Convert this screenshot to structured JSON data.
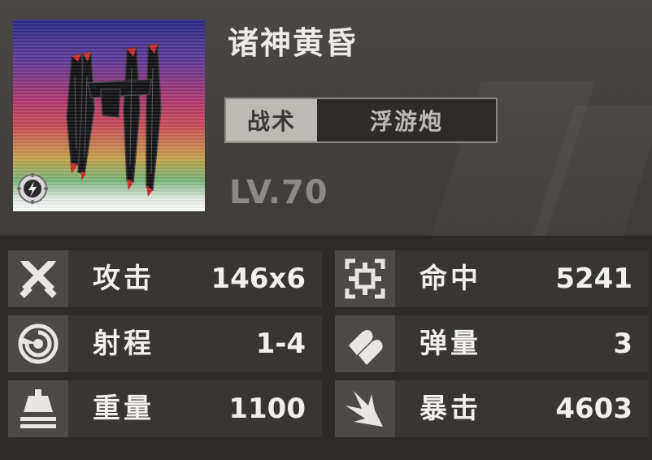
{
  "equipment": {
    "name": "诸神黄昏",
    "category": "战术",
    "type": "浮游炮",
    "level": "LV.70",
    "badge": "lightning-badge-icon"
  },
  "stats": [
    {
      "label": "攻击",
      "value": "146x6",
      "icon": "crossed-swords-icon"
    },
    {
      "label": "命中",
      "value": "5241",
      "icon": "crosshair-icon"
    },
    {
      "label": "射程",
      "value": "1-4",
      "icon": "radar-icon"
    },
    {
      "label": "弹量",
      "value": "3",
      "icon": "bullets-icon"
    },
    {
      "label": "重量",
      "value": "1100",
      "icon": "weight-icon"
    },
    {
      "label": "暴击",
      "value": "4603",
      "icon": "critical-burst-icon"
    }
  ],
  "colors": {
    "background": "#2e2c2a",
    "row": "#383634",
    "icon_box": "#4c4946",
    "text": "#f1f0ed",
    "category_bg": "#bdbab5"
  }
}
